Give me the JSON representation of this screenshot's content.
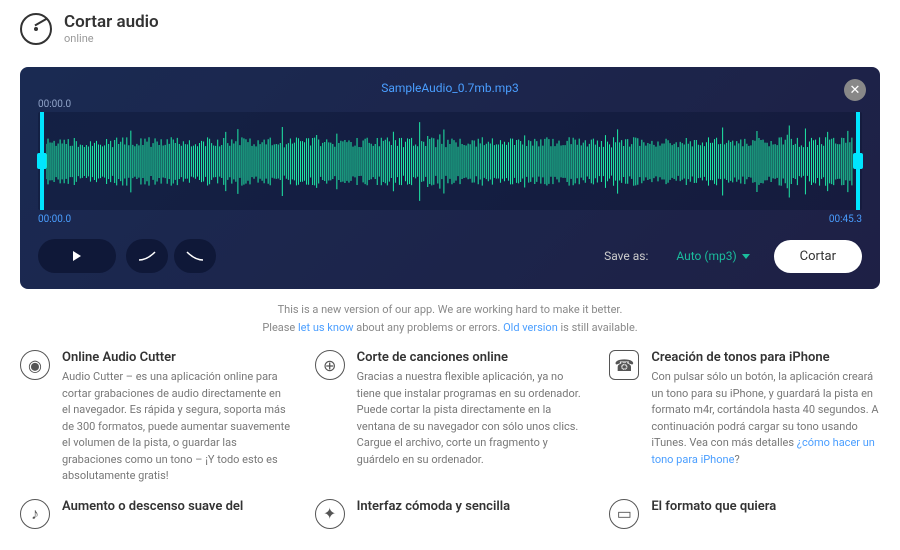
{
  "header": {
    "title": "Cortar audio",
    "subtitle": "online"
  },
  "editor": {
    "filename": "SampleAudio_0.7mb.mp3",
    "time_top": "00:00.0",
    "time_start": "00:00.0",
    "time_end": "00:45.3",
    "save_as_label": "Save as:",
    "format": "Auto (mp3)",
    "cut_label": "Cortar"
  },
  "notice": {
    "line1_a": "This is a new version of our app. We are working hard to make it better.",
    "line2_a": "Please ",
    "link1": "let us know",
    "line2_b": " about any problems or errors. ",
    "link2": "Old version",
    "line2_c": " is still available."
  },
  "features": [
    {
      "title": "Online Audio Cutter",
      "text": "Audio Cutter – es una aplicación online para cortar grabaciones de audio directamente en el navegador. Es rápida y segura, soporta más de 300 formatos, puede aumentar suavemente el volumen de la pista, o guardar las grabaciones como un tono – ¡Y todo esto es absolutamente gratis!"
    },
    {
      "title": "Corte de canciones online",
      "text": "Gracias a nuestra flexible aplicación, ya no tiene que instalar programas en su ordenador. Puede cortar la pista directamente en la ventana de su navegador con sólo unos clics. Cargue el archivo, corte un fragmento y guárdelo en su ordenador."
    },
    {
      "title": "Creación de tonos para iPhone",
      "text": "Con pulsar sólo un botón, la aplicación creará un tono para su iPhone, y guardará la pista en formato m4r, cortándola hasta 40 segundos. A continuación podrá cargar su tono usando iTunes. Vea con más detalles ",
      "link": "¿cómo hacer un tono para iPhone",
      "tail": "?"
    }
  ],
  "features2": [
    {
      "title": "Aumento o descenso suave del"
    },
    {
      "title": "Interfaz cómoda y sencilla"
    },
    {
      "title": "El formato que quiera"
    }
  ]
}
